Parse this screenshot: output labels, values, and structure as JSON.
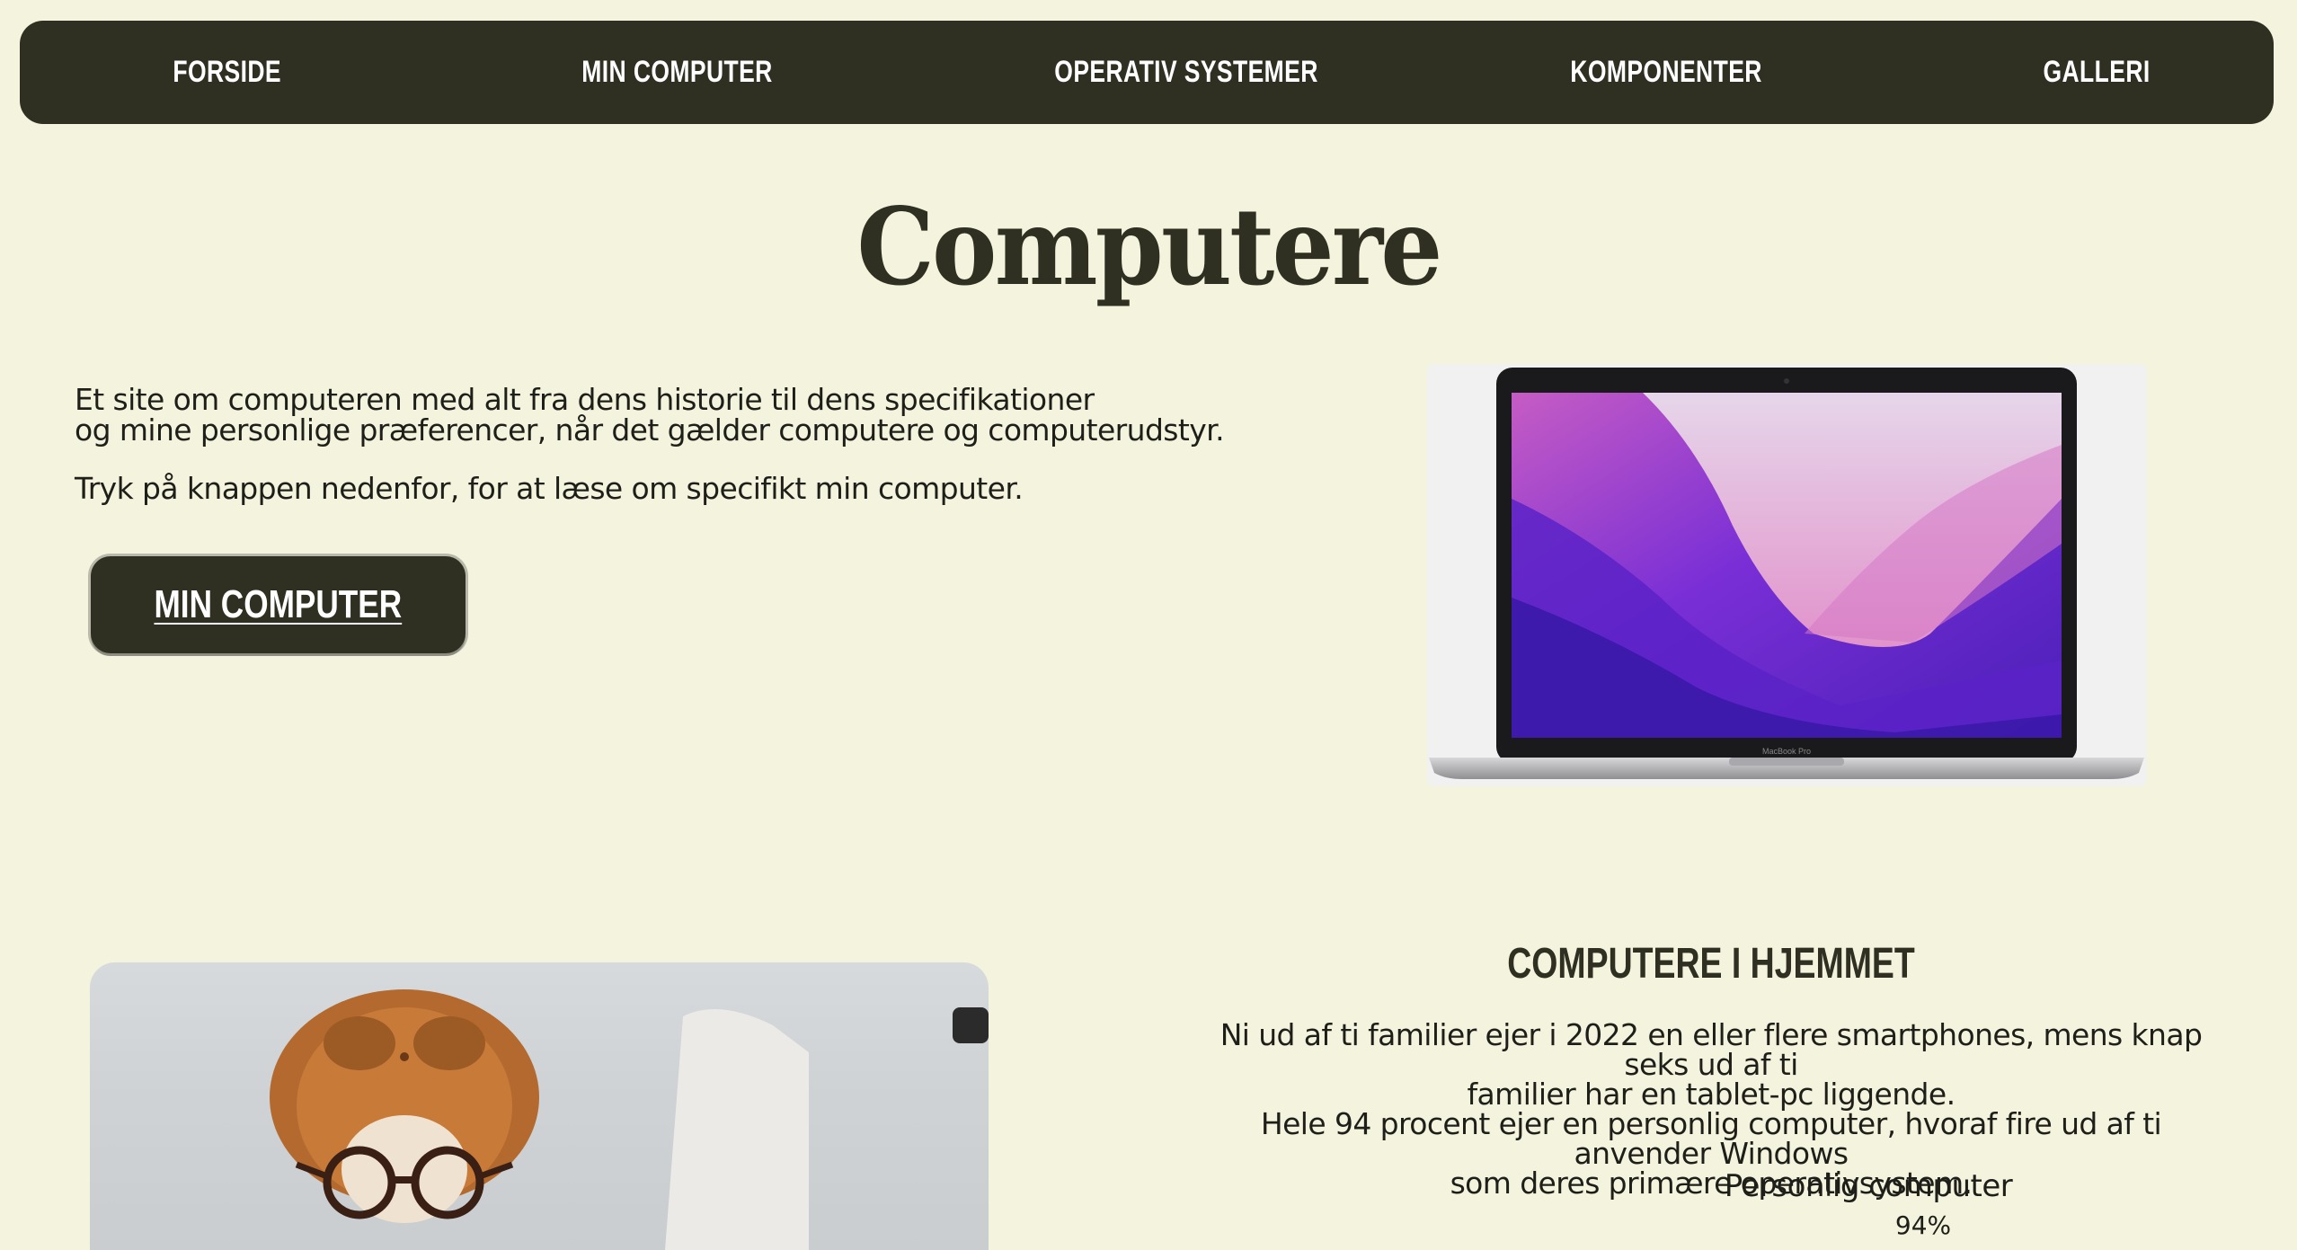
{
  "nav": {
    "items": [
      "FORSIDE",
      "MIN COMPUTER",
      "OPERATIV SYSTEMER",
      "KOMPONENTER",
      "GALLERI"
    ]
  },
  "hero": {
    "title": "Computere",
    "intro_line1": "Et site om computeren med alt fra dens historie til dens specifikationer",
    "intro_line2": "og mine personlige præferencer, når det gælder computere og computerudstyr.",
    "intro_line3": "Tryk på knappen nedenfor, for at læse om specifikt min computer.",
    "button_label": "MIN COMPUTER",
    "laptop_label": "MacBook Pro"
  },
  "section": {
    "title": "COMPUTERE I HJEMMET",
    "text_line1": "Ni ud af ti familier ejer i 2022 en eller flere smartphones, mens knap seks ud af ti",
    "text_line2": "familier har en tablet-pc liggende.",
    "text_line3": "Hele 94 procent ejer en personlig computer, hvoraf fire ud af ti anvender Windows",
    "text_line4": "som deres primære operativsystem.",
    "stat_label": "Personlig computer",
    "stat_value": "94%"
  },
  "colors": {
    "background": "#f4f3dd",
    "nav_bg": "#2f2f22",
    "accent_dark": "#2f2f22",
    "text": "#1f1f1a"
  }
}
